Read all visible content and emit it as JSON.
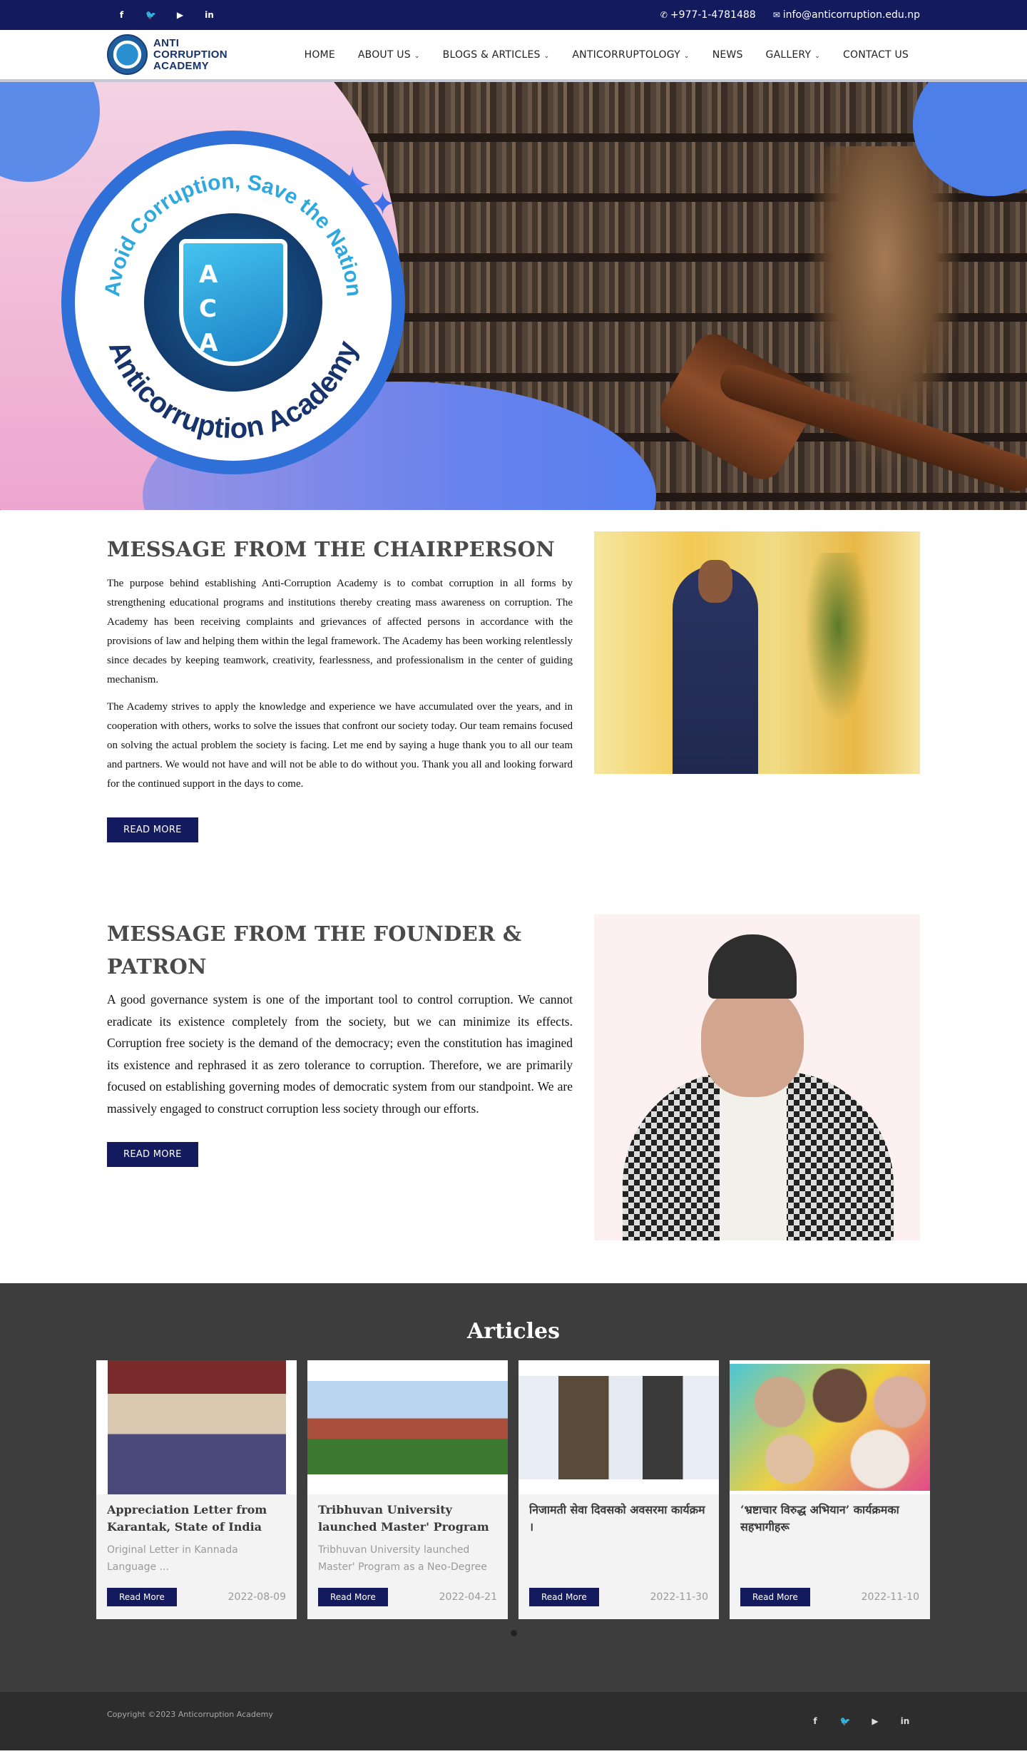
{
  "topbar": {
    "social": [
      {
        "icon": "facebook-icon",
        "glyph": "f"
      },
      {
        "icon": "twitter-icon",
        "glyph": "🐦"
      },
      {
        "icon": "youtube-icon",
        "glyph": "▶"
      },
      {
        "icon": "linkedin-icon",
        "glyph": "in"
      }
    ],
    "phone": "+977-1-4781488",
    "email": "info@anticorruption.edu.np"
  },
  "brand": {
    "line1": "ANTI",
    "line2": "CORRUPTION",
    "line3": "ACADEMY"
  },
  "nav": {
    "items": [
      {
        "label": "HOME",
        "dropdown": false
      },
      {
        "label": "ABOUT US",
        "dropdown": true
      },
      {
        "label": "BLOGS & ARTICLES",
        "dropdown": true
      },
      {
        "label": "ANTICORRUPTOLOGY",
        "dropdown": true
      },
      {
        "label": "NEWS",
        "dropdown": false
      },
      {
        "label": "GALLERY",
        "dropdown": true
      },
      {
        "label": "CONTACT US",
        "dropdown": false
      }
    ]
  },
  "hero": {
    "seal_top": "Avoid Corruption, Save the Nation",
    "seal_bottom": "Anticorruption Academy",
    "letters": [
      "A",
      "C",
      "A"
    ]
  },
  "chair": {
    "heading": "MESSAGE FROM THE CHAIRPERSON",
    "p1": "The purpose behind establishing Anti-Corruption Academy is to combat corruption in all forms by strengthening educational programs and institutions thereby creating mass awareness on corruption. The Academy has been receiving complaints and grievances of affected persons in accordance with the provisions of law and helping them within the legal framework. The Academy has been working relentlessly since decades by keeping teamwork, creativity, fearlessness, and professionalism in the center of guiding mechanism.",
    "p2": "The Academy strives to apply the knowledge and experience we have accumulated over the years, and in cooperation with others, works to solve the issues that confront our society today. Our team remains focused on solving the actual problem the society is facing. Let me end by saying a huge thank you to all our team and partners. We would not have and will not be able to do without you. Thank you all and looking forward for the continued support in the days to come.",
    "button": "READ MORE"
  },
  "founder": {
    "heading": "MESSAGE FROM THE FOUNDER & PATRON",
    "p1": "A good governance system is one of the important tool to control corruption. We cannot eradicate its existence completely from the society, but we can minimize its effects. Corruption free society is the demand of the democracy; even the constitution has imagined its existence and rephrased it as zero tolerance to corruption. Therefore, we are primarily focused on establishing governing modes of democratic system from our standpoint. We are massively engaged to construct corruption less society through our efforts.",
    "button": "READ MORE"
  },
  "articles": {
    "heading": "Articles",
    "cards": [
      {
        "title": "Appreciation Letter from Karantak, State of India",
        "excerpt": "Original Letter in Kannada Language ...",
        "button": "Read More",
        "date": "2022-08-09"
      },
      {
        "title": "Tribhuvan University launched Master' Program",
        "excerpt": "Tribhuvan University launched Master' Program as a Neo-Degree Tribhuvan",
        "button": "Read More",
        "date": "2022-04-21"
      },
      {
        "title": "निजामती सेवा दिवसको अवसरमा कार्यक्रम ।",
        "excerpt": "",
        "button": "Read More",
        "date": "2022-11-30"
      },
      {
        "title": "‘भ्रष्टाचार विरुद्ध अभियान’ कार्यक्रमका सहभागीहरू",
        "excerpt": "",
        "button": "Read More",
        "date": "2022-11-10"
      }
    ]
  },
  "footer": {
    "copyright": "Copyright ©2023 Anticorruption Academy"
  },
  "colors": {
    "navy": "#141a5e",
    "dark_section": "#3d3d3d",
    "footer": "#2d2d2d"
  }
}
